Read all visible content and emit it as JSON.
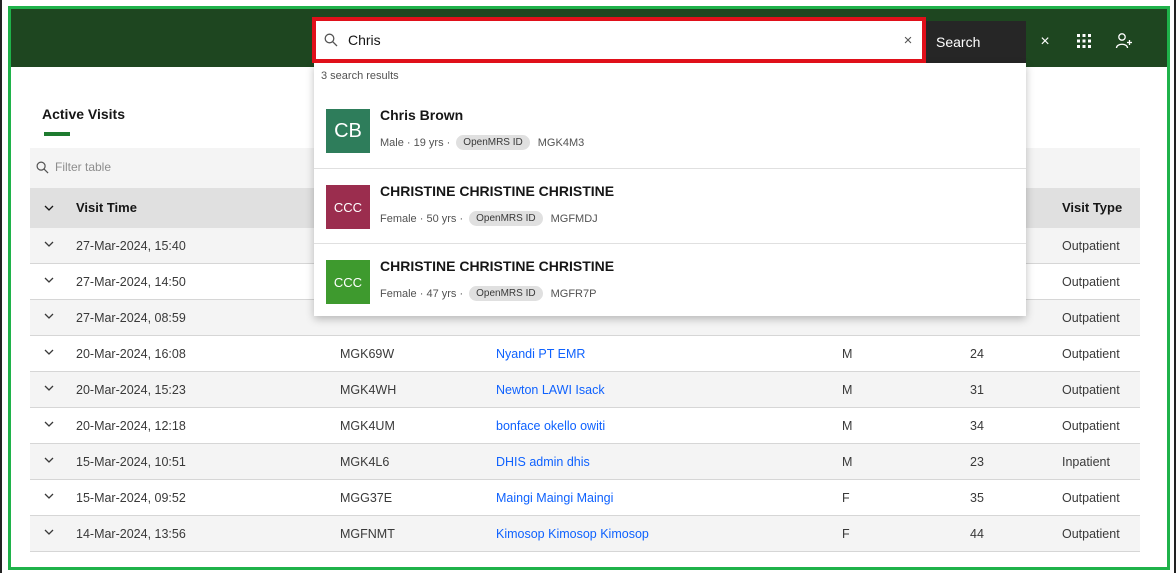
{
  "header": {
    "search_value": "Chris",
    "search_button": "Search",
    "close_label": "×"
  },
  "results": {
    "count_text": "3 search results",
    "items": [
      {
        "initials": "CB",
        "name": "Chris Brown",
        "meta": "Male · 19 yrs ·",
        "id_label": "OpenMRS ID",
        "id": "MGK4M3",
        "color": "#2e7d5b"
      },
      {
        "initials": "CCC",
        "name": "CHRISTINE CHRISTINE CHRISTINE",
        "meta": "Female · 50 yrs ·",
        "id_label": "OpenMRS ID",
        "id": "MGFMDJ",
        "color": "#9b2d4e"
      },
      {
        "initials": "CCC",
        "name": "CHRISTINE CHRISTINE CHRISTINE",
        "meta": "Female · 47 yrs ·",
        "id_label": "OpenMRS ID",
        "id": "MGFR7P",
        "color": "#3e9a2e"
      }
    ]
  },
  "visits": {
    "title": "Active Visits",
    "filter_placeholder": "Filter table",
    "columns": {
      "time": "Visit Time",
      "type": "Visit Type"
    },
    "rows": [
      {
        "time": "27-Mar-2024, 15:40",
        "id": "",
        "name": "",
        "gender": "",
        "age": "",
        "type": "Outpatient"
      },
      {
        "time": "27-Mar-2024, 14:50",
        "id": "",
        "name": "",
        "gender": "",
        "age": "",
        "type": "Outpatient"
      },
      {
        "time": "27-Mar-2024, 08:59",
        "id": "",
        "name": "",
        "gender": "",
        "age": "",
        "type": "Outpatient"
      },
      {
        "time": "20-Mar-2024, 16:08",
        "id": "MGK69W",
        "name": "Nyandi PT EMR",
        "gender": "M",
        "age": "24",
        "type": "Outpatient"
      },
      {
        "time": "20-Mar-2024, 15:23",
        "id": "MGK4WH",
        "name": "Newton LAWI Isack",
        "gender": "M",
        "age": "31",
        "type": "Outpatient"
      },
      {
        "time": "20-Mar-2024, 12:18",
        "id": "MGK4UM",
        "name": "bonface okello owiti",
        "gender": "M",
        "age": "34",
        "type": "Outpatient"
      },
      {
        "time": "15-Mar-2024, 10:51",
        "id": "MGK4L6",
        "name": "DHIS admin dhis",
        "gender": "M",
        "age": "23",
        "type": "Inpatient"
      },
      {
        "time": "15-Mar-2024, 09:52",
        "id": "MGG37E",
        "name": "Maingi Maingi Maingi",
        "gender": "F",
        "age": "35",
        "type": "Outpatient"
      },
      {
        "time": "14-Mar-2024, 13:56",
        "id": "MGFNMT",
        "name": "Kimosop Kimosop Kimosop",
        "gender": "F",
        "age": "44",
        "type": "Outpatient"
      }
    ]
  },
  "colors": {
    "header_bg": "#1e4620",
    "highlight_border": "#e0101a",
    "frame_border": "#1fb24a",
    "link": "#0f62fe"
  }
}
